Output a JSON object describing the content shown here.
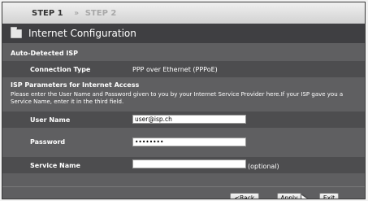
{
  "wizard": {
    "step1": "STEP 1",
    "step2": "STEP 2",
    "arrow": "»"
  },
  "page": {
    "title": "Internet Configuration",
    "auto_detected_heading": "Auto-Detected ISP"
  },
  "connection": {
    "label": "Connection Type",
    "value": "PPP over Ethernet (PPPoE)"
  },
  "isp": {
    "heading": "ISP Parameters for Internet Access",
    "description": "Please enter the User Name and Password given to you by your Internet Service Provider here.If your ISP gave you a Service Name, enter it in the third field."
  },
  "fields": {
    "username": {
      "label": "User Name",
      "value": "user@isp.ch"
    },
    "password": {
      "label": "Password",
      "value": "••••••••"
    },
    "service": {
      "label": "Service Name",
      "value": "",
      "note": "(optional)"
    }
  },
  "buttons": {
    "back": "<Back",
    "apply": "Apply",
    "exit": "Exit"
  },
  "icons": {
    "title_icon": "folder-icon",
    "arrow_icon": "chevron-right-icon",
    "cursor_icon": "mouse-pointer-icon"
  }
}
